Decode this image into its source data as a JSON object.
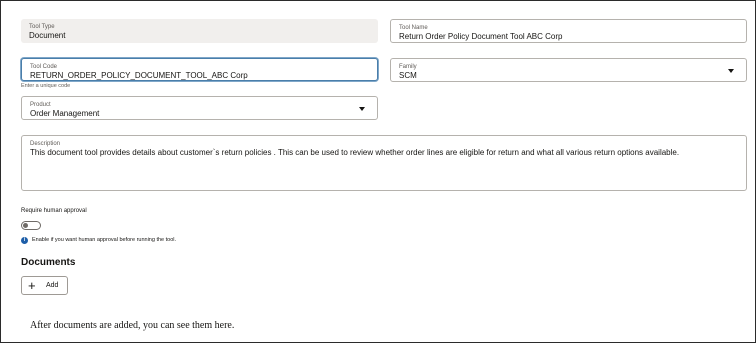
{
  "tool_type": {
    "label": "Tool Type",
    "value": "Document"
  },
  "tool_name": {
    "label": "Tool Name",
    "value": "Return Order Policy Document Tool ABC Corp"
  },
  "tool_code": {
    "label": "Tool Code",
    "value": "RETURN_ORDER_POLICY_DOCUMENT_TOOL_ABC Corp",
    "hint": "Enter a unique code"
  },
  "family": {
    "label": "Family",
    "value": "SCM"
  },
  "product": {
    "label": "Product",
    "value": "Order Management"
  },
  "description": {
    "label": "Description",
    "value": "This document tool provides details about customer`s return policies . This can be used to review whether order lines are eligible for return and what all various return options available."
  },
  "approval": {
    "label": "Require human approval",
    "enabled": false,
    "info": "Enable if you want human approval before running the tool."
  },
  "documents": {
    "title": "Documents",
    "add_label": "Add",
    "empty_message": "After documents are added, you can see them here."
  }
}
